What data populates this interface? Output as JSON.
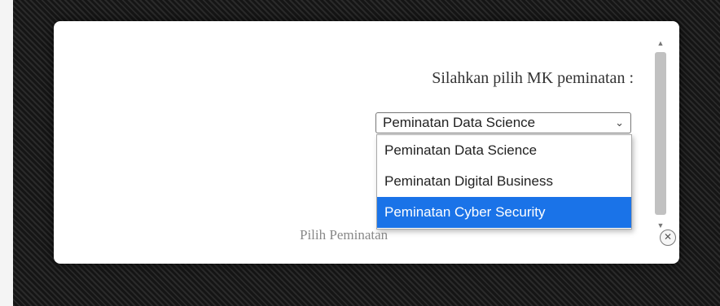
{
  "dialog": {
    "prompt": "Silahkan pilih MK peminatan :",
    "select": {
      "selected_value": "Peminatan Data Science",
      "options": [
        "Peminatan Data Science",
        "Peminatan Digital Business",
        "Peminatan Cyber Security"
      ],
      "highlighted_index": 2
    },
    "submit_label": "Pilih Peminatan",
    "close_icon": "close-icon"
  },
  "colors": {
    "highlight": "#1a73e8",
    "backdrop": "#1e1e1e"
  }
}
